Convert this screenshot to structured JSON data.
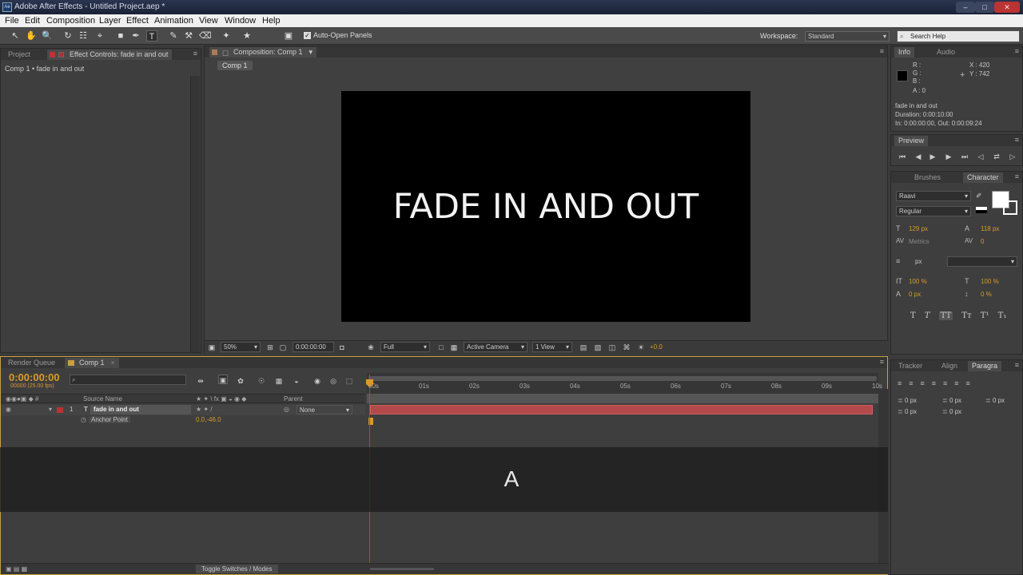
{
  "window": {
    "title": "Adobe After Effects - Untitled Project.aep *",
    "app_icon": "Ae"
  },
  "menu": [
    "File",
    "Edit",
    "Composition",
    "Layer",
    "Effect",
    "Animation",
    "View",
    "Window",
    "Help"
  ],
  "toolbar": {
    "auto_open_label": "Auto-Open Panels",
    "workspace_label": "Workspace:",
    "workspace_value": "Standard",
    "search_placeholder": "Search Help"
  },
  "project_panel": {
    "tab_project": "Project",
    "tab_effect": "Effect Controls: fade in and out",
    "breadcrumb": "Comp 1 • fade in and out"
  },
  "comp_panel": {
    "tab": "Composition: Comp 1",
    "subtab": "Comp 1",
    "text": "FADE IN AND OUT",
    "zoom": "50%",
    "time": "0:00:00:00",
    "resolution": "Full",
    "camera": "Active Camera",
    "views": "1 View",
    "exposure": "+0.0"
  },
  "info_panel": {
    "tab_info": "Info",
    "tab_audio": "Audio",
    "r": "R :",
    "g": "G :",
    "b": "B :",
    "a": "A : 0",
    "x": "X : 420",
    "y": "Y : 742",
    "layer_name": "fade in and out",
    "duration": "Duration: 0:00:10:00",
    "inout": "In: 0:00:00:00, Out: 0:00:09:24"
  },
  "preview_panel": {
    "tab": "Preview"
  },
  "character_panel": {
    "tab_brushes": "Brushes",
    "tab_character": "Character",
    "font": "Raavi",
    "style": "Regular",
    "size": "129 px",
    "leading": "118 px",
    "kerning": "Metrics",
    "tracking": "0",
    "stroke": "px",
    "vscale": "100 %",
    "hscale": "100 %",
    "baseline": "0 px",
    "tsume": "0 %"
  },
  "para_panel": {
    "tab_tracker": "Tracker",
    "tab_align": "Align",
    "tab_para": "Paragra",
    "indent1": "0 px",
    "indent2": "0 px",
    "indent3": "0 px",
    "space1": "0 px",
    "space2": "0 px"
  },
  "timeline": {
    "tab_render": "Render Queue",
    "tab_comp": "Comp 1",
    "timecode": "0:00:00:00",
    "frames": "00000 (25.00 fps)",
    "col_source": "Source Name",
    "col_parent": "Parent",
    "layer_num": "1",
    "layer_type": "T",
    "layer_name": "fade in and out",
    "parent_value": "None",
    "prop_name": "Anchor Point",
    "prop_value": "0.0,-46.0",
    "toggle_label": "Toggle Switches / Modes",
    "ruler": [
      "00s",
      "01s",
      "02s",
      "03s",
      "04s",
      "05s",
      "06s",
      "07s",
      "08s",
      "09s",
      "10s"
    ]
  },
  "overlay": {
    "letter": "A"
  },
  "colors": {
    "accent": "#d99a2a",
    "layer_bar": "#b24a4a",
    "bg": "#3b3b3b"
  }
}
